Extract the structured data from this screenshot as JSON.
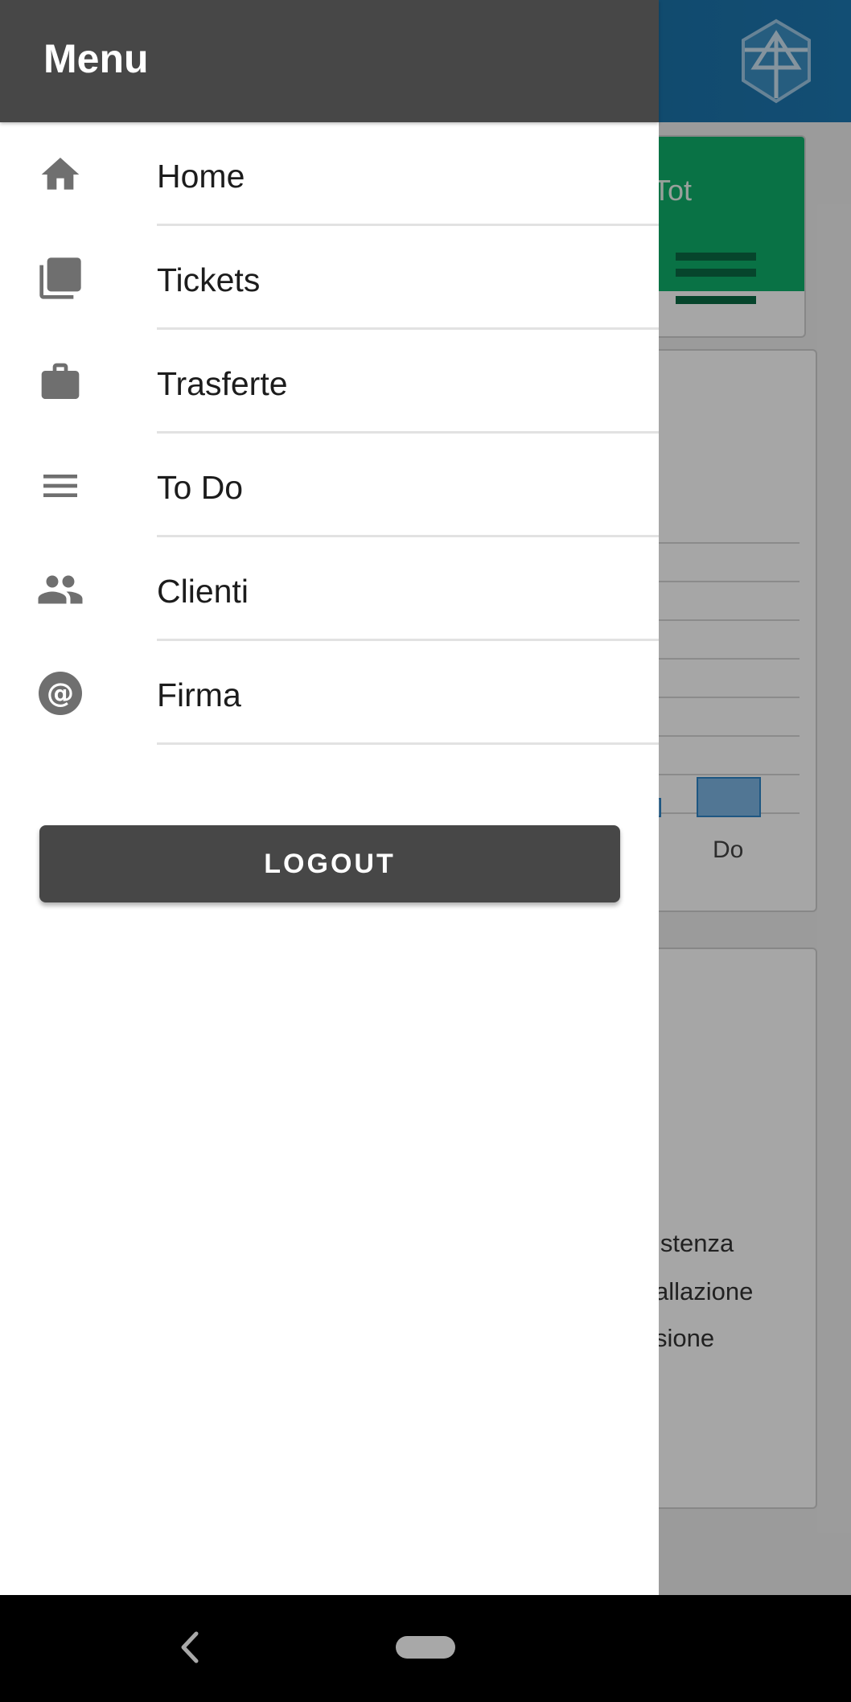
{
  "drawer": {
    "title": "Menu",
    "items": [
      {
        "label": "Home",
        "icon": "home-icon"
      },
      {
        "label": "Tickets",
        "icon": "tickets-icon"
      },
      {
        "label": "Trasferte",
        "icon": "briefcase-icon"
      },
      {
        "label": "To Do",
        "icon": "list-icon"
      },
      {
        "label": "Clienti",
        "icon": "people-icon"
      },
      {
        "label": "Firma",
        "icon": "at-sign-icon"
      }
    ],
    "logout_label": "LOGOUT"
  },
  "background": {
    "green_card_label": "Tot",
    "chart_x_label": "Do",
    "list_items": [
      "istenza",
      "allazione",
      "sione"
    ]
  },
  "colors": {
    "header_gray": "#474747",
    "app_blue": "#1d78b2",
    "accent_green": "#0eb06b",
    "icon_gray": "#6f6f6f"
  }
}
